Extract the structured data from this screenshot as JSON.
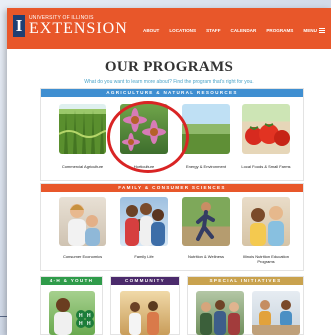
{
  "header": {
    "logo_letter": "I",
    "logo_university": "UNIVERSITY OF ILLINOIS",
    "logo_extension": "EXTENSION",
    "nav": [
      "ABOUT",
      "LOCATIONS",
      "STAFF",
      "CALENDAR",
      "PROGRAMS",
      "MENU"
    ]
  },
  "page_title": "OUR PROGRAMS",
  "page_subtitle": "What do you want to learn more about? Find the program that's right for you.",
  "sections": {
    "agriculture": {
      "heading": "AGRICULTURE & NATURAL RESOURCES",
      "color": "#3f8fd1",
      "tiles": [
        {
          "label": "Commercial Agriculture"
        },
        {
          "label": "Horticulture"
        },
        {
          "label": "Energy & Environment"
        },
        {
          "label": "Local Foods & Small Farms"
        }
      ]
    },
    "family": {
      "heading": "FAMILY & CONSUMER SCIENCES",
      "color": "#e8572a",
      "tiles": [
        {
          "label": "Consumer Economics"
        },
        {
          "label": "Family Life"
        },
        {
          "label": "Nutrition & Wellness"
        },
        {
          "label": "Illinois Nutrition Education Programs"
        }
      ]
    },
    "youth": {
      "heading": "4-H & YOUTH",
      "color": "#2f9b4a"
    },
    "community": {
      "heading": "COMMUNITY",
      "color": "#4b2a6b"
    },
    "special": {
      "heading": "SPECIAL INITIATIVES",
      "color": "#c9a24e"
    }
  },
  "highlight": {
    "target": "Horticulture",
    "color": "#d92424"
  }
}
